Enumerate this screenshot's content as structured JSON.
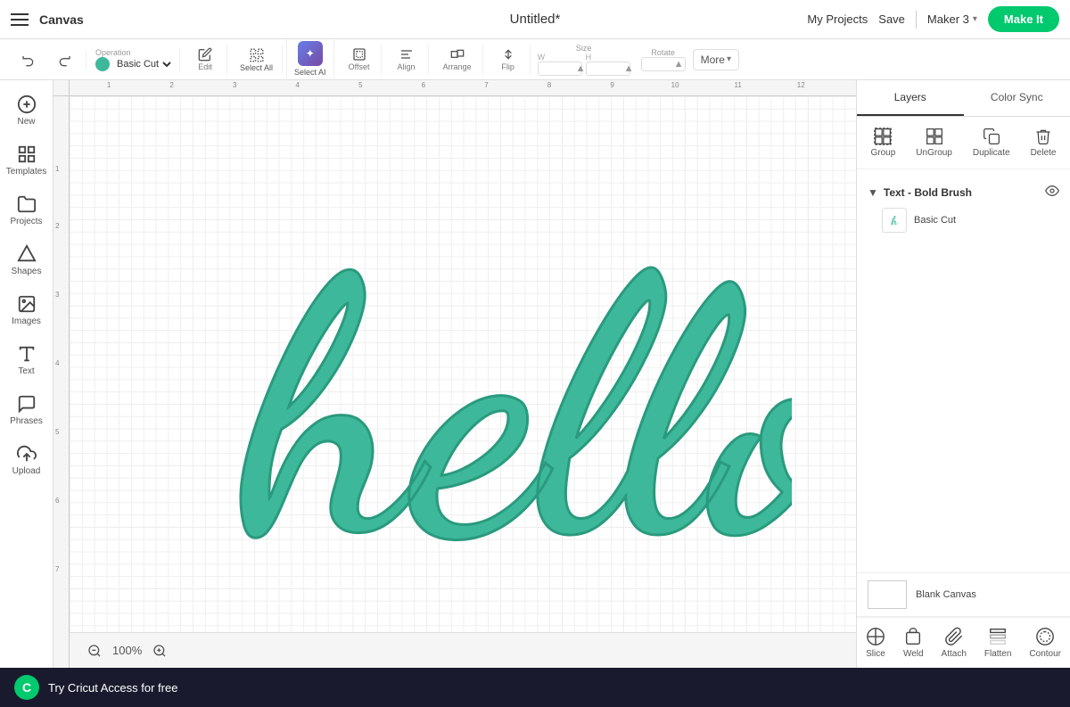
{
  "app": {
    "title": "Canvas",
    "document_title": "Untitled*",
    "my_projects": "My Projects",
    "save": "Save",
    "maker": "Maker 3",
    "make_it": "Make It"
  },
  "toolbar": {
    "operation_label": "Operation",
    "operation_value": "Basic Cut",
    "edit_label": "Edit",
    "offset_label": "Offset",
    "select_all_label": "Select All",
    "align_label": "Align",
    "arrange_label": "Arrange",
    "flip_label": "Flip",
    "size_label": "Size",
    "w_label": "W",
    "h_label": "H",
    "rotate_label": "Rotate",
    "more_label": "More"
  },
  "sidebar": {
    "items": [
      {
        "id": "new",
        "label": "New",
        "icon": "+"
      },
      {
        "id": "templates",
        "label": "Templates",
        "icon": "⊞"
      },
      {
        "id": "projects",
        "label": "Projects",
        "icon": "📁"
      },
      {
        "id": "shapes",
        "label": "Shapes",
        "icon": "△"
      },
      {
        "id": "images",
        "label": "Images",
        "icon": "🖼"
      },
      {
        "id": "text",
        "label": "Text",
        "icon": "T"
      },
      {
        "id": "phrases",
        "label": "Phrases",
        "icon": "💬"
      },
      {
        "id": "upload",
        "label": "Upload",
        "icon": "↑"
      }
    ],
    "select_ai": "Select AI"
  },
  "zoom": {
    "level": "100%",
    "minus_label": "−",
    "plus_label": "+"
  },
  "right_panel": {
    "tabs": [
      {
        "id": "layers",
        "label": "Layers"
      },
      {
        "id": "color_sync",
        "label": "Color Sync"
      }
    ],
    "active_tab": "layers",
    "actions": {
      "group": "Group",
      "ungroup": "UnGroup",
      "duplicate": "Duplicate",
      "delete": "Delete"
    },
    "layer_group": {
      "title": "Text - Bold Brush",
      "items": [
        {
          "id": "basic_cut",
          "label": "Basic Cut",
          "icon": "h"
        }
      ]
    },
    "blank_canvas_label": "Blank Canvas",
    "bottom_actions": {
      "slice": "Slice",
      "weld": "Weld",
      "attach": "Attach",
      "flatten": "Flatten",
      "contour": "Contour"
    }
  },
  "banner": {
    "text": "Try Cricut Access for free",
    "logo": "C"
  },
  "colors": {
    "teal": "#3db89a",
    "green": "#00c96e",
    "dark": "#1a1a2e",
    "accent": "#667eea"
  }
}
